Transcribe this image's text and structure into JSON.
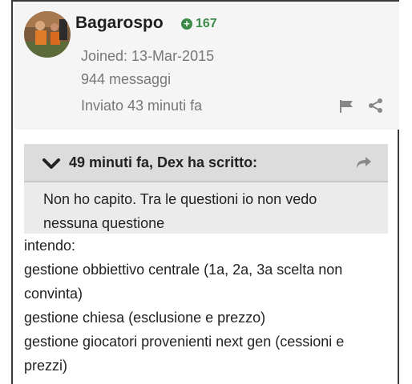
{
  "post": {
    "author": "Bagarospo",
    "reputation": "167",
    "joined": "Joined: 13-Mar-2015",
    "messages": "944 messaggi",
    "sent": "Inviato 43 minuti fa"
  },
  "quote": {
    "header": "49 minuti fa, Dex ha scritto:",
    "text_lines": [
      "Non ho capito. Tra le questioni io non vedo",
      "nessuna questione"
    ]
  },
  "body_lines": [
    "intendo:",
    "gestione obbiettivo centrale (1a, 2a, 3a scelta non",
    "convinta)",
    "gestione chiesa (esclusione e prezzo)",
    "gestione giocatori provenienti next gen (cessioni e",
    "prezzi)"
  ],
  "icons": {
    "reputation": "plus-circle-icon",
    "report": "flag-icon",
    "share": "share-icon",
    "collapse": "chevron-down-icon",
    "go_to_quote": "forward-arrow-icon"
  },
  "colors": {
    "reputation": "#3b8a47",
    "header_bg": "#f5f5f5",
    "quote_header_bg": "#dcdcdc",
    "quote_bg": "#ebebeb",
    "meta_text": "#777777"
  }
}
